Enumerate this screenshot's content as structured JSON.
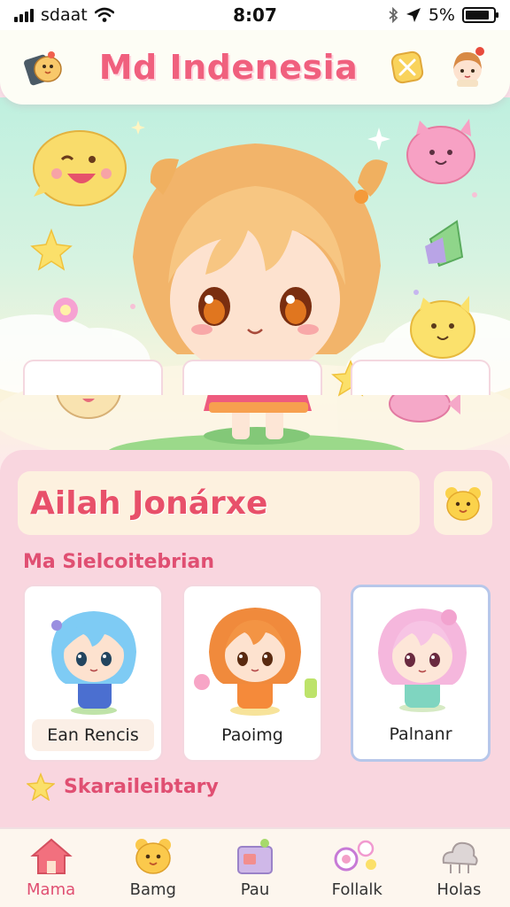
{
  "status_bar": {
    "carrier": "sdaat",
    "time": "8:07",
    "battery": "5%",
    "battery_level": 0.85
  },
  "header": {
    "title": "Md Indenesia",
    "left_icon": "chick-icon",
    "right_icon": "avatar",
    "badge_icon": "shield-icon"
  },
  "profile": {
    "name": "Ailah Jonárxe"
  },
  "sections": {
    "selection_title": "Ma Sielcoitebrian",
    "featured_title": "Skaraileibtary"
  },
  "characters": [
    {
      "label": "Ean Rencis",
      "hair": "#7ecbf4",
      "outfit": "#4b6fd0",
      "selected": false
    },
    {
      "label": "Paoimg",
      "hair": "#f08a3c",
      "outfit": "#f58a3a",
      "selected": false
    },
    {
      "label": "Palnanr",
      "hair": "#f5b7dd",
      "outfit": "#7fd5c0",
      "selected": true
    }
  ],
  "nav": [
    {
      "label": "Mama",
      "icon": "house-icon",
      "active": true
    },
    {
      "label": "Bamg",
      "icon": "bear-icon",
      "active": false
    },
    {
      "label": "Pau",
      "icon": "gift-box-icon",
      "active": false
    },
    {
      "label": "Follalk",
      "icon": "candy-icon",
      "active": false
    },
    {
      "label": "Holas",
      "icon": "cloud-icon",
      "active": false
    }
  ],
  "colors": {
    "accent": "#f0607e",
    "panel": "#f9d6df",
    "hero_top": "#bff0df"
  }
}
